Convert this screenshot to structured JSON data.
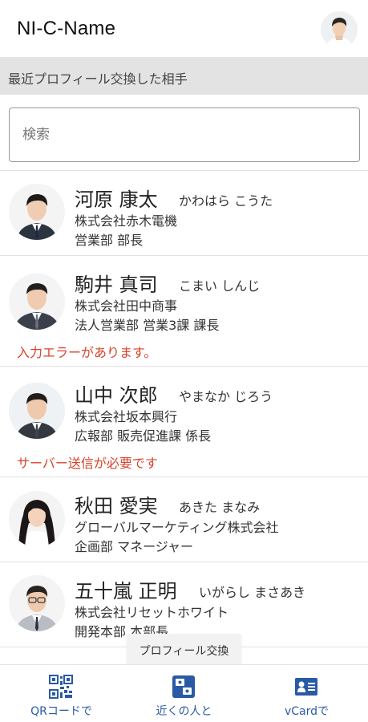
{
  "app": {
    "title": "NI-C-Name"
  },
  "section": {
    "recent_label": "最近プロフィール交換した相手"
  },
  "search": {
    "placeholder": "検索"
  },
  "contacts": [
    {
      "name": "河原 康太",
      "kana": "かわはら こうた",
      "company": "株式会社赤木電機",
      "dept": "営業部 部長",
      "error": ""
    },
    {
      "name": "駒井 真司",
      "kana": "こまい しんじ",
      "company": "株式会社田中商事",
      "dept": "法人営業部 営業3課 課長",
      "error": "入力エラーがあります。"
    },
    {
      "name": "山中 次郎",
      "kana": "やまなか じろう",
      "company": "株式会社坂本興行",
      "dept": "広報部 販売促進課 係長",
      "error": "サーバー送信が必要です"
    },
    {
      "name": "秋田 愛実",
      "kana": "あきた まなみ",
      "company": "グローバルマーケティング株式会社",
      "dept": "企画部 マネージャー",
      "error": ""
    },
    {
      "name": "五十嵐 正明",
      "kana": "いがらし まさあき",
      "company": "株式会社リセットホワイト",
      "dept": "開発本部 本部長",
      "error": ""
    }
  ],
  "tooltip": {
    "label": "プロフィール交換"
  },
  "nav": {
    "qr_label": "QRコードで",
    "nearby_label": "近くの人と",
    "vcard_label": "vCardで"
  },
  "colors": {
    "error": "#d9432a",
    "nav_accent": "#2a5aa6",
    "section_bg": "#e3e3e3"
  },
  "icons": {
    "qr": "qr-code-icon",
    "nearby": "nearby-exchange-icon",
    "vcard": "vcard-icon"
  }
}
